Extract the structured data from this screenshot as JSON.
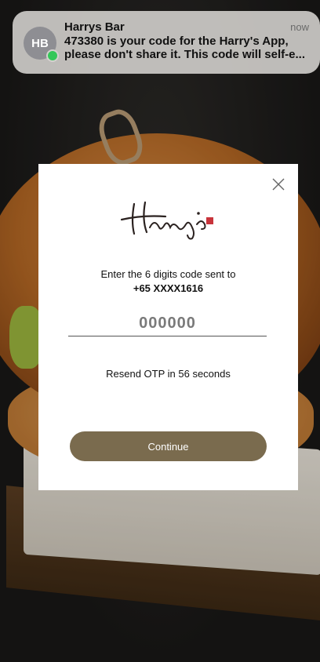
{
  "notification": {
    "app_initials": "HB",
    "title": "Harrys Bar",
    "time": "now",
    "body": "473380 is your code for the Harry's App, please don't share it. This code will self-e..."
  },
  "modal": {
    "logo_text": "Harrys",
    "instruction": "Enter the 6 digits code sent to",
    "phone": "+65 XXXX1616",
    "otp": {
      "value": "",
      "placeholder": "000000"
    },
    "resend": "Resend OTP in 56 seconds",
    "continue_label": "Continue"
  },
  "colors": {
    "accent": "#7a6b4e",
    "logo_ink": "#2b2220",
    "seal": "#c8343b"
  }
}
